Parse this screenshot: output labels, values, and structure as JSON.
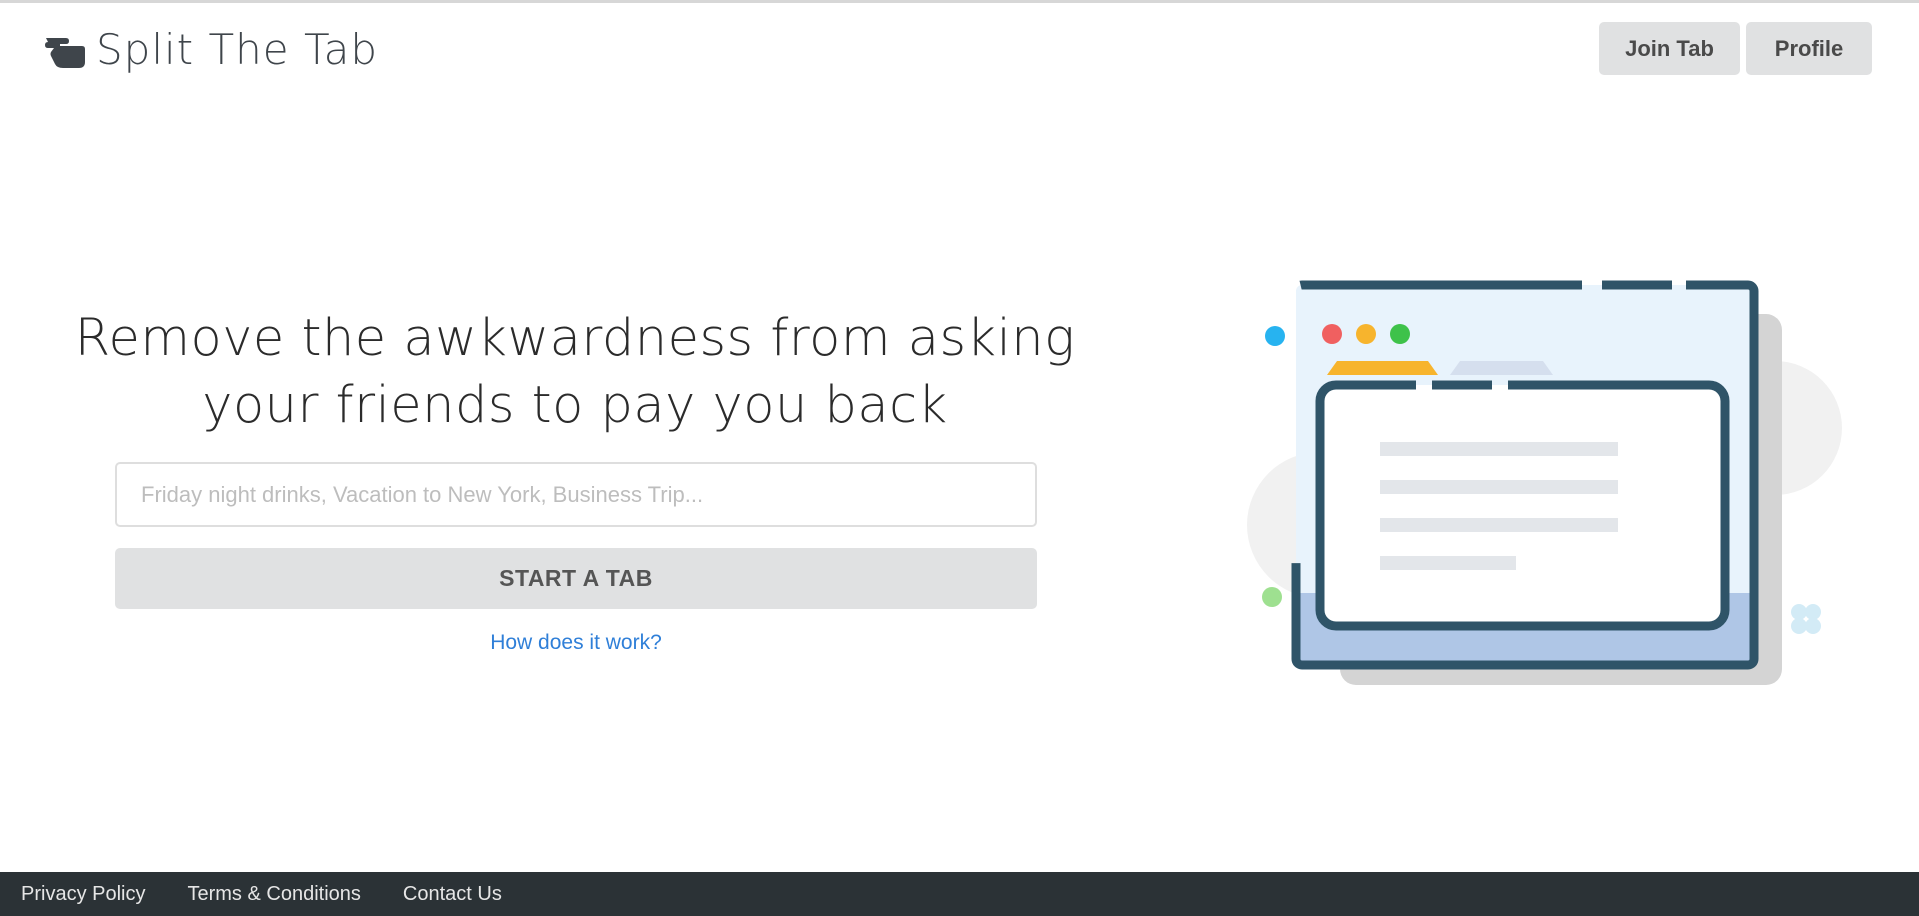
{
  "header": {
    "brand_name": "Split The Tab",
    "brand_icon": "pointing-hand-icon",
    "nav": {
      "join_tab_label": "Join Tab",
      "profile_label": "Profile"
    }
  },
  "hero": {
    "title_line1": "Remove the awkwardness from asking",
    "title_line2": "your friends to pay you back",
    "tab_name_input": {
      "value": "",
      "placeholder": "Friday night drinks, Vacation to New York, Business Trip..."
    },
    "start_button_label": "START A TAB",
    "how_it_works_link": "How does it work?"
  },
  "illustration": {
    "icon": "browser-window-illustration-icon"
  },
  "footer": {
    "links": [
      "Privacy Policy",
      "Terms & Conditions",
      "Contact Us"
    ]
  },
  "colors": {
    "button_bg": "#e0e1e2",
    "link": "#2f7fd8",
    "footer_bg": "#2b3236",
    "illustration_frame": "#2f5468"
  }
}
